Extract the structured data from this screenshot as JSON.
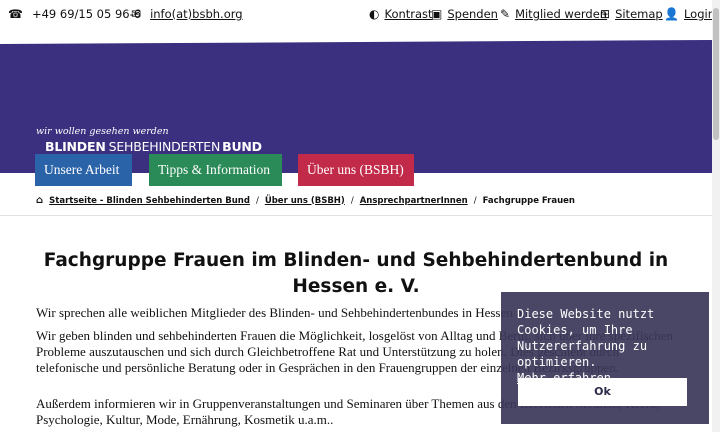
{
  "topbar": {
    "phone": "+49 69/15 05 96-6",
    "email": "info(at)bsbh.org",
    "contrast": "Kontrast",
    "donate": "Spenden",
    "member": "Mitglied werden",
    "sitemap": "Sitemap",
    "login": "Login"
  },
  "logo": {
    "slogan": "wir wollen gesehen werden",
    "name_bold": "BLINDEN",
    "name_thin": "SEHBEHINDERTEN",
    "name_bold2": "BUND"
  },
  "nav": {
    "item1": "Unsere Arbeit",
    "item2": "Tipps & Information",
    "item3": "Über uns (BSBH)"
  },
  "breadcrumb": {
    "home": "Startseite - Blinden Sehbehinderten Bund",
    "level2": "Über uns (BSBH)",
    "level3": "AnsprechpartnerInnen",
    "current": "Fachgruppe Frauen"
  },
  "main": {
    "title": "Fachgruppe Frauen im Blinden- und Sehbehindertenbund in Hessen e. V.",
    "p1": "Wir sprechen alle weiblichen Mitglieder des Blinden- und Sehbehindertenbundes in Hessen an.",
    "p2": "Wir geben blinden und sehbehinderten Frauen die Möglichkeit, losgelöst von Alltag und Beruf, sich über ihre spezifischen Probleme auszutauschen und sich durch Gleichbetroffene Rat und Unterstützung zu holen. Dies geschieht durch telefonische und persönliche Beratung oder in Gesprächen in den Frauengruppen der einzelnen Bezirksgruppen.",
    "p3": "Außerdem informieren wir in Gruppenveranstaltungen und Seminaren über Themen aus den Bereichen Medizin, Recht, Psychologie, Kultur, Mode, Ernährung, Kosmetik u.a.m.."
  },
  "cookie": {
    "text": "Diese Website nutzt Cookies, um Ihre Nutzererfahrung zu optimieren.",
    "more": "Mehr erfahren",
    "ok": "Ok"
  },
  "colors": {
    "header": "#3b2f7f",
    "nav1": "#2a63a8",
    "nav2": "#2a8a58",
    "nav3": "#c22a4a"
  }
}
